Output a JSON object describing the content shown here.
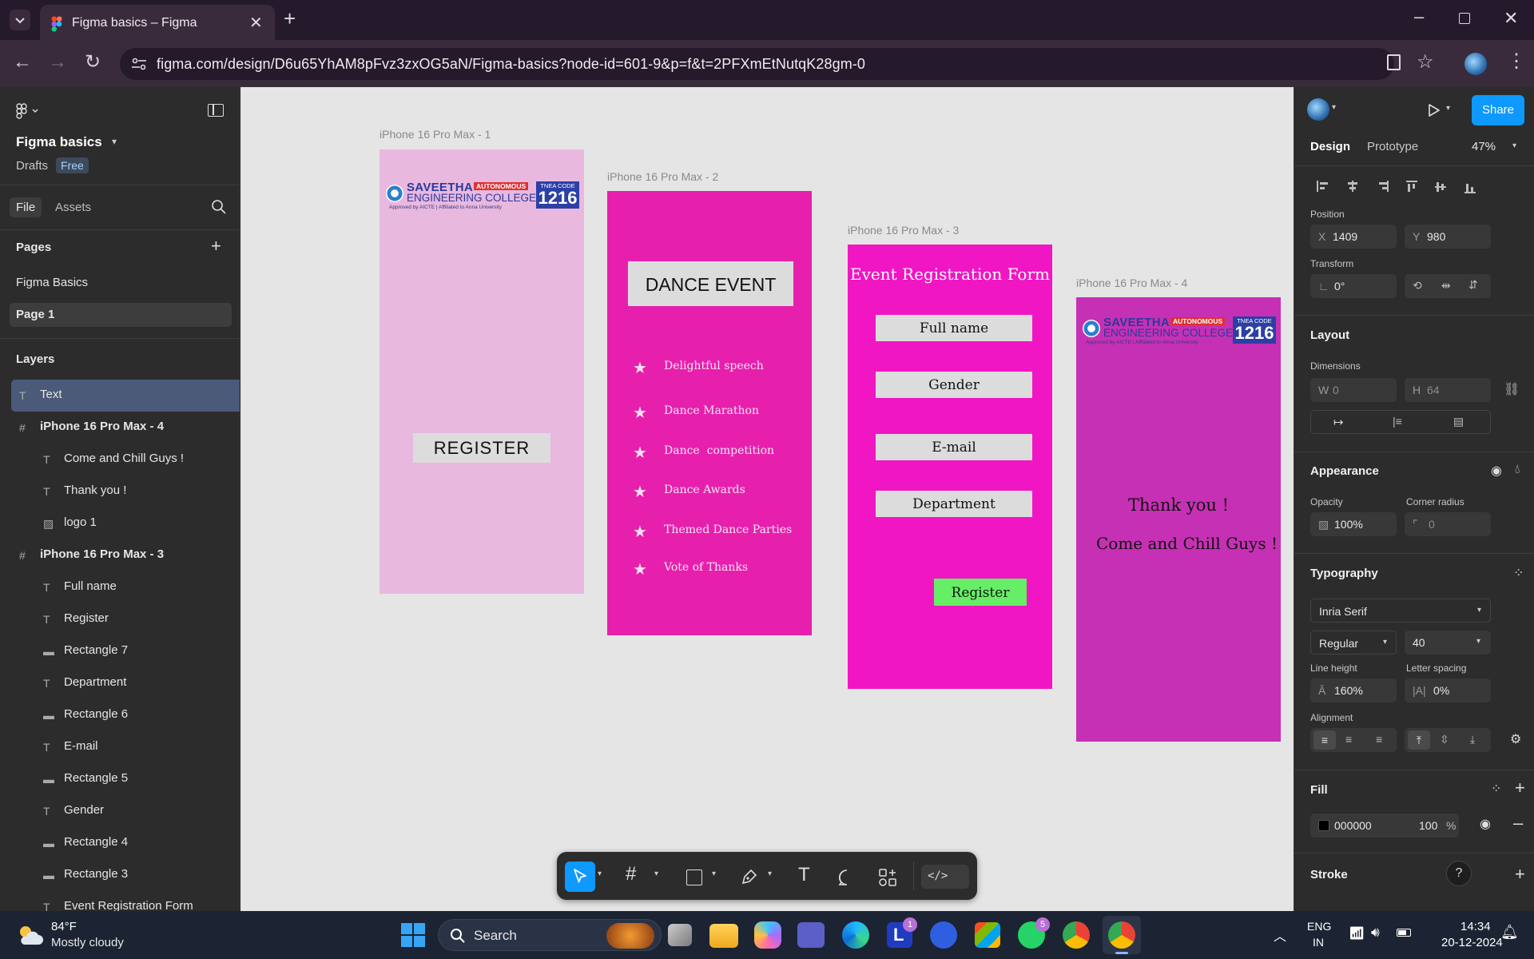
{
  "browser": {
    "tab_title": "Figma basics – Figma",
    "url": "figma.com/design/D6u65YhAM8pFvz3zxOG5aN/Figma-basics?node-id=601-9&p=f&t=2PFXmEtNutqK28gm-0"
  },
  "file": {
    "name": "Figma basics",
    "location": "Drafts",
    "plan_badge": "Free"
  },
  "left_tabs": [
    "File",
    "Assets"
  ],
  "pages": {
    "heading": "Pages",
    "items": [
      "Figma Basics",
      "Page 1"
    ],
    "selected": "Page 1"
  },
  "layers": {
    "heading": "Layers",
    "items": [
      {
        "label": "Text",
        "kind": "text",
        "depth": 0
      },
      {
        "label": "iPhone 16 Pro Max - 4",
        "kind": "frame",
        "depth": 0
      },
      {
        "label": "Come and Chill Guys !",
        "kind": "text",
        "depth": 1
      },
      {
        "label": "Thank you !",
        "kind": "text",
        "depth": 1
      },
      {
        "label": "logo 1",
        "kind": "image",
        "depth": 1
      },
      {
        "label": "iPhone 16 Pro Max - 3",
        "kind": "frame",
        "depth": 0
      },
      {
        "label": "Full name",
        "kind": "text",
        "depth": 1
      },
      {
        "label": "Register",
        "kind": "text",
        "depth": 1
      },
      {
        "label": "Rectangle 7",
        "kind": "rect",
        "depth": 1
      },
      {
        "label": "Department",
        "kind": "text",
        "depth": 1
      },
      {
        "label": "Rectangle 6",
        "kind": "rect",
        "depth": 1
      },
      {
        "label": "E-mail",
        "kind": "text",
        "depth": 1
      },
      {
        "label": "Rectangle 5",
        "kind": "rect",
        "depth": 1
      },
      {
        "label": "Gender",
        "kind": "text",
        "depth": 1
      },
      {
        "label": "Rectangle 4",
        "kind": "rect",
        "depth": 1
      },
      {
        "label": "Rectangle 3",
        "kind": "rect",
        "depth": 1
      },
      {
        "label": "Event Registration Form",
        "kind": "text",
        "depth": 1
      }
    ]
  },
  "canvas": {
    "frame1": {
      "label": "iPhone 16 Pro Max - 1",
      "button": "REGISTER",
      "color": "#e8b8df"
    },
    "frame2": {
      "label": "iPhone 16 Pro Max - 2",
      "title": "DANCE EVENT",
      "items": [
        "Delightful speech",
        "Dance Marathon",
        "Dance  competition",
        "Dance Awards",
        "Themed Dance Parties",
        "Vote of Thanks"
      ],
      "color": "#e620ad"
    },
    "frame3": {
      "label": "iPhone 16 Pro Max - 3",
      "title": "Event Registration Form",
      "fields": [
        "Full name",
        "Gender",
        "E-mail",
        "Department"
      ],
      "button": "Register",
      "color": "#f016c3",
      "button_color": "#66ee66"
    },
    "frame4": {
      "label": "iPhone 16 Pro Max - 4",
      "line1": "Thank you !",
      "line2": "Come and Chill Guys !",
      "color": "#c630b5"
    },
    "logo": {
      "name": "SAVEETHA",
      "sub": "ENGINEERING COLLEGE",
      "badge": "AUTONOMOUS",
      "tagline": "Approved by AICTE  |  Affiliated to Anna University",
      "code_label": "TNEA CODE",
      "code": "1216"
    }
  },
  "right": {
    "share": "Share",
    "tabs": [
      "Design",
      "Prototype"
    ],
    "zoom": "47%",
    "position": {
      "label": "Position",
      "x": "1409",
      "y": "980"
    },
    "transform": {
      "label": "Transform",
      "rotation": "0°"
    },
    "layout": {
      "heading": "Layout",
      "dims_label": "Dimensions",
      "w": "0",
      "h": "64"
    },
    "appearance": {
      "heading": "Appearance",
      "opacity_label": "Opacity",
      "opacity": "100%",
      "radius_label": "Corner radius",
      "radius": "0"
    },
    "typography": {
      "heading": "Typography",
      "font": "Inria Serif",
      "weight": "Regular",
      "size": "40",
      "lh_label": "Line height",
      "lh": "160%",
      "ls_label": "Letter spacing",
      "ls": "0%",
      "align_label": "Alignment"
    },
    "fill": {
      "heading": "Fill",
      "hex": "000000",
      "opacity": "100",
      "pct": "%"
    },
    "stroke": {
      "heading": "Stroke"
    }
  },
  "taskbar": {
    "weather_temp": "84°F",
    "weather_desc": "Mostly cloudy",
    "search": "Search",
    "lang1": "ENG",
    "lang2": "IN",
    "time": "14:34",
    "date": "20-12-2024",
    "badge_l": "1",
    "badge_wa": "5"
  }
}
